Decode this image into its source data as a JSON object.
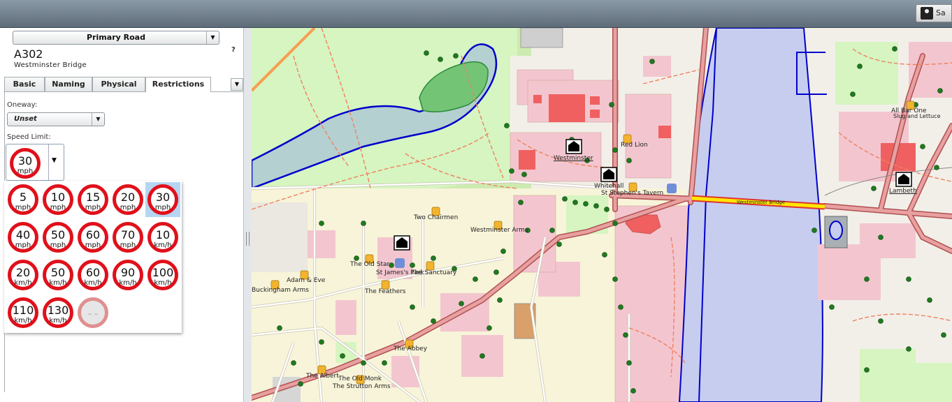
{
  "topbar": {
    "button_label": "Sa"
  },
  "panel": {
    "feature_type": "Primary Road",
    "ref": "A302",
    "name": "Westminster Bridge",
    "help": "?",
    "tabs": [
      "Basic",
      "Naming",
      "Physical",
      "Restrictions"
    ],
    "active_tab": "Restrictions",
    "oneway_label": "Oneway:",
    "oneway_value": "Unset",
    "speed_label": "Speed Limit:",
    "speed_current": {
      "value": "30",
      "unit": "mph"
    },
    "speed_options": [
      {
        "value": "5",
        "unit": "mph"
      },
      {
        "value": "10",
        "unit": "mph"
      },
      {
        "value": "15",
        "unit": "mph"
      },
      {
        "value": "20",
        "unit": "mph"
      },
      {
        "value": "30",
        "unit": "mph"
      },
      {
        "value": "40",
        "unit": "mph"
      },
      {
        "value": "50",
        "unit": "mph"
      },
      {
        "value": "60",
        "unit": "mph"
      },
      {
        "value": "70",
        "unit": "mph"
      },
      {
        "value": "10",
        "unit": "km/h"
      },
      {
        "value": "20",
        "unit": "km/h"
      },
      {
        "value": "50",
        "unit": "km/h"
      },
      {
        "value": "60",
        "unit": "km/h"
      },
      {
        "value": "90",
        "unit": "km/h"
      },
      {
        "value": "100",
        "unit": "km/h"
      },
      {
        "value": "110",
        "unit": "km/h"
      },
      {
        "value": "130",
        "unit": "km/h"
      },
      {
        "value": "– –",
        "unit": ""
      }
    ],
    "selected_option": "30 mph"
  },
  "map": {
    "labels": {
      "westminster": "Westminster",
      "red_lion": "Red Lion",
      "whitehall": "Whitehall",
      "st_stephens": "St Stephen's Tavern",
      "westminster_bridge_road": "Westminster Bridge",
      "two_chairmen": "Two Chairmen",
      "westminster_arms": "Westminster Arms",
      "old_star": "The Old Star",
      "st_james": "St James's Park",
      "sanctuary": "The Sanctuary",
      "adam_eve": "Adam & Eve",
      "buckingham_arms": "Buckingham Arms",
      "feathers": "The Feathers",
      "abbey": "The Abbey",
      "albert": "The Albert",
      "old_monk": "The Old Monk",
      "strutton_arms": "The Strutton Arms",
      "all_bar_one": "All Bar One",
      "slug_lettuce": "Slug and Lettuce",
      "lambeth": "Lambeth"
    },
    "colors": {
      "water": "#b5d0d0",
      "river": "#c6cdef",
      "park": "#d6f5c1",
      "building": "#f3c6cf",
      "road_primary": "#d88a8a",
      "selected_way": "#ffe600",
      "speed_sign_red": "#e0101a"
    }
  }
}
